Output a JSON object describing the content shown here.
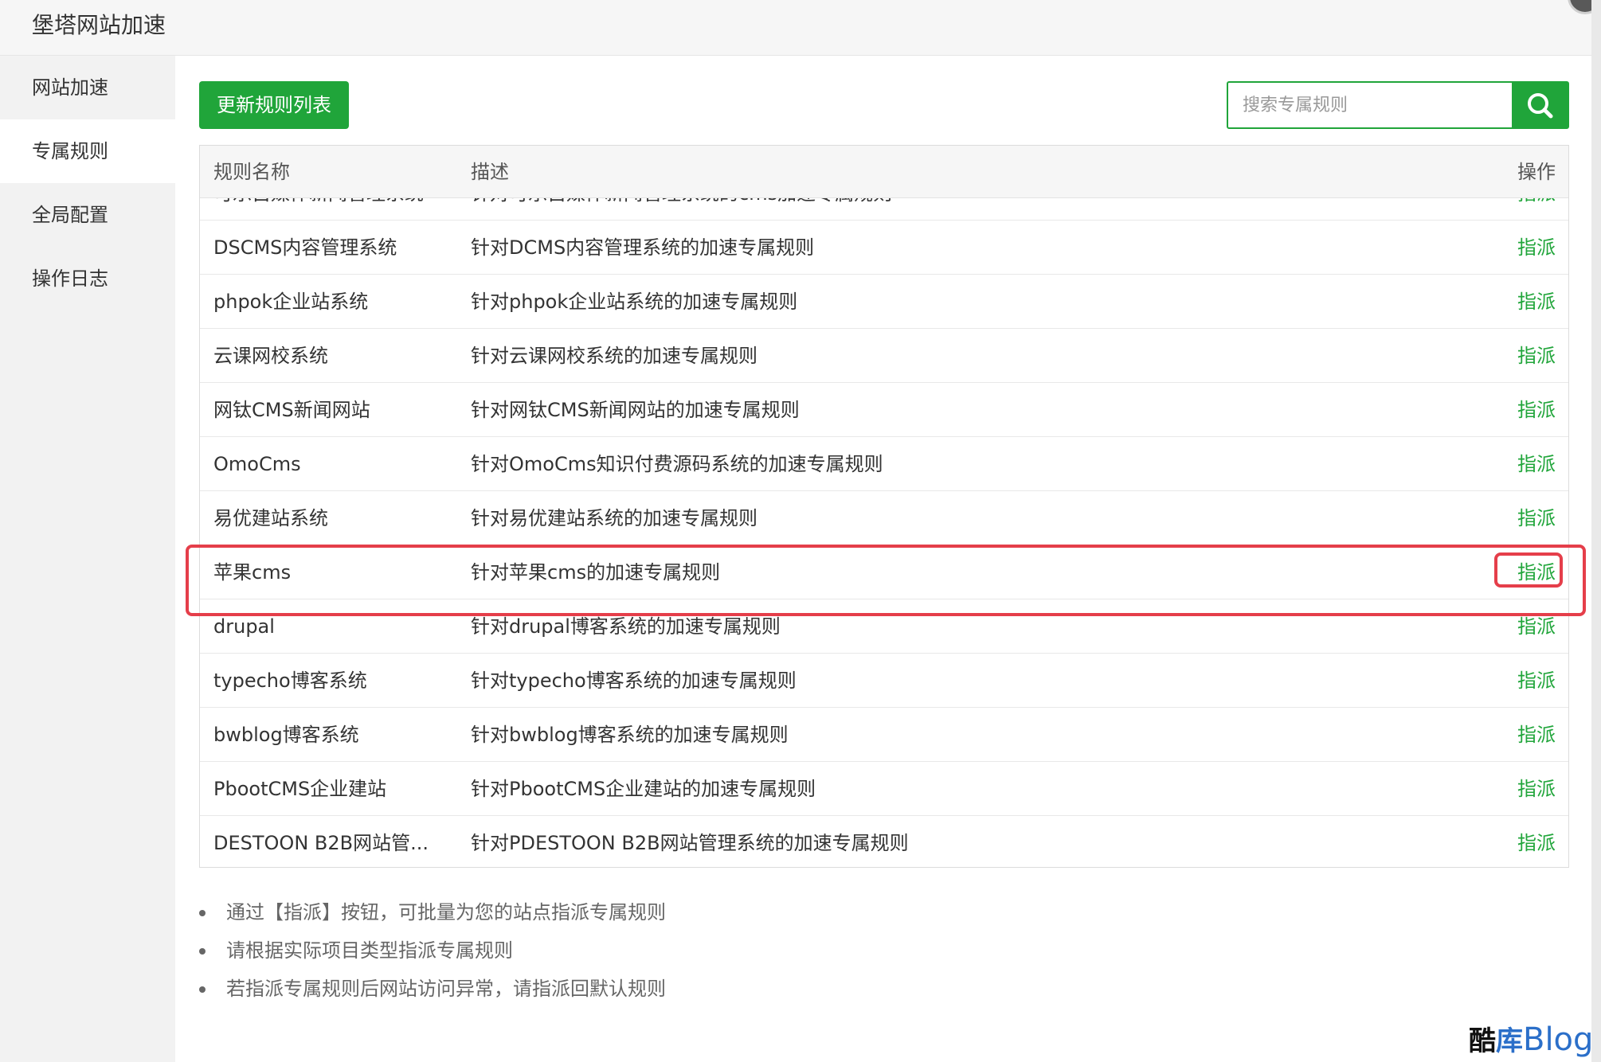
{
  "window": {
    "title": "堡塔网站加速"
  },
  "sidebar": {
    "items": [
      {
        "label": "网站加速"
      },
      {
        "label": "专属规则"
      },
      {
        "label": "全局配置"
      },
      {
        "label": "操作日志"
      }
    ]
  },
  "toolbar": {
    "update_label": "更新规则列表",
    "search_placeholder": "搜索专属规则"
  },
  "table": {
    "headers": {
      "name": "规则名称",
      "desc": "描述",
      "op": "操作"
    },
    "partial_row": {
      "name": "可乐自媒体新闻管理系统",
      "desc": "针对可乐自媒体新闻管理系统的cms加速专属规则",
      "op": "指派"
    },
    "rows": [
      {
        "name": "DSCMS内容管理系统",
        "desc": "针对DCMS内容管理系统的加速专属规则",
        "op": "指派"
      },
      {
        "name": "phpok企业站系统",
        "desc": "针对phpok企业站系统的加速专属规则",
        "op": "指派"
      },
      {
        "name": "云课网校系统",
        "desc": "针对云课网校系统的加速专属规则",
        "op": "指派"
      },
      {
        "name": "网钛CMS新闻网站",
        "desc": "针对网钛CMS新闻网站的加速专属规则",
        "op": "指派"
      },
      {
        "name": "OmoCms",
        "desc": "针对OmoCms知识付费源码系统的加速专属规则",
        "op": "指派"
      },
      {
        "name": "易优建站系统",
        "desc": "针对易优建站系统的加速专属规则",
        "op": "指派"
      },
      {
        "name": "苹果cms",
        "desc": "针对苹果cms的加速专属规则",
        "op": "指派"
      },
      {
        "name": "drupal",
        "desc": "针对drupal博客系统的加速专属规则",
        "op": "指派"
      },
      {
        "name": "typecho博客系统",
        "desc": "针对typecho博客系统的加速专属规则",
        "op": "指派"
      },
      {
        "name": "bwblog博客系统",
        "desc": "针对bwblog博客系统的加速专属规则",
        "op": "指派"
      },
      {
        "name": "PbootCMS企业建站",
        "desc": "针对PbootCMS企业建站的加速专属规则",
        "op": "指派"
      },
      {
        "name": "DESTOON B2B网站管...",
        "desc": "针对PDESTOON B2B网站管理系统的加速专属规则",
        "op": "指派"
      }
    ]
  },
  "tips": [
    "通过【指派】按钮，可批量为您的站点指派专属规则",
    "请根据实际项目类型指派专属规则",
    "若指派专属规则后网站访问异常，请指派回默认规则"
  ],
  "watermark": {
    "part1": "酷",
    "part2": "库",
    "part3": "Blog"
  },
  "colors": {
    "accent": "#20a53a",
    "highlight": "#e53e4a"
  }
}
